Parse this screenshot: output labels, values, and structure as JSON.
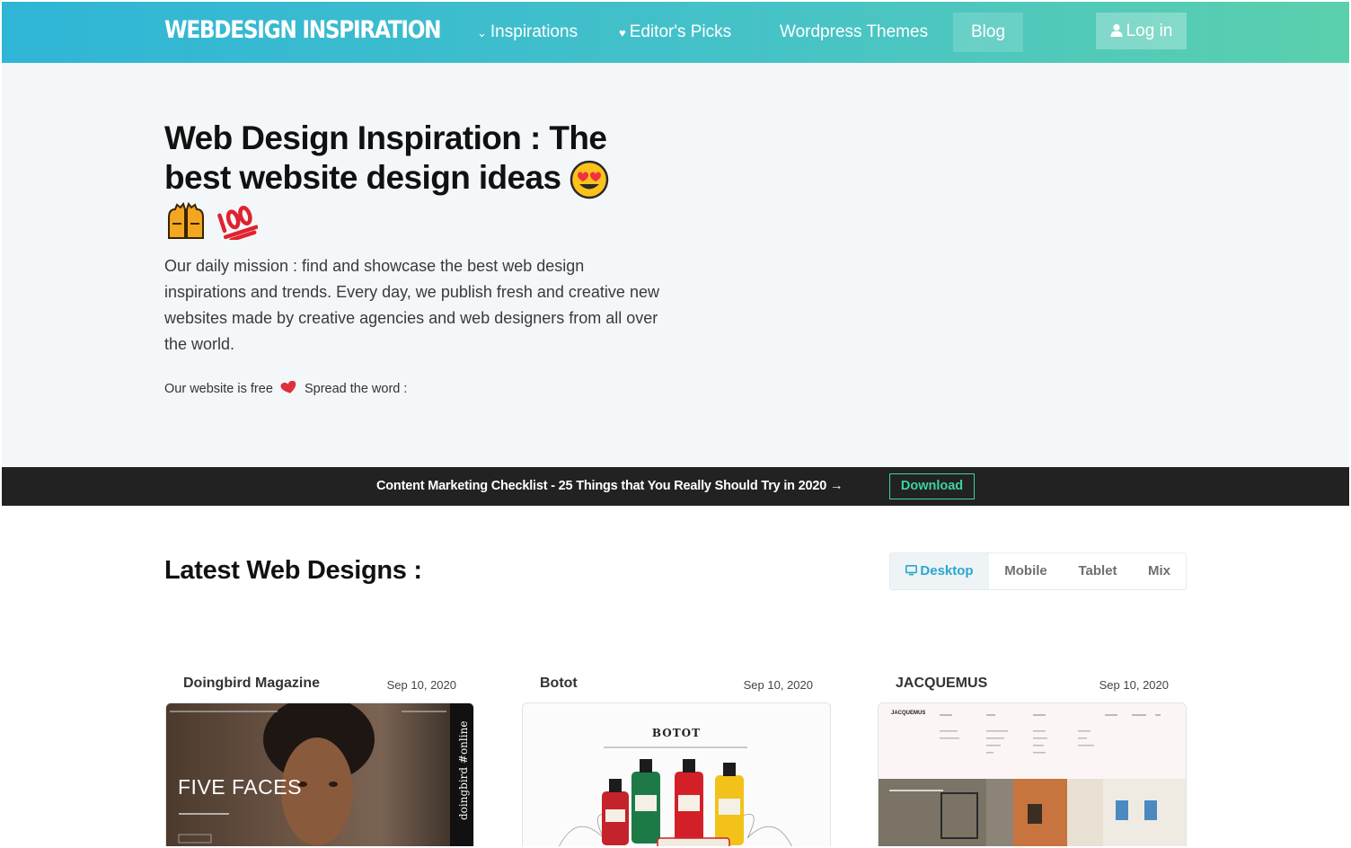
{
  "nav": {
    "logo": "WEBDESIGN INSPIRATION",
    "items": [
      {
        "label": "Inspirations",
        "glyph": "⌄"
      },
      {
        "label": "Editor's Picks",
        "glyph": "♥"
      },
      {
        "label": "Wordpress Themes"
      },
      {
        "label": "Blog"
      }
    ],
    "login_label": "Log in"
  },
  "hero": {
    "title": "Web Design Inspiration : The best website design ideas",
    "description": "Our daily mission : find and showcase the best web design inspirations and trends. Every day, we publish fresh and creative new websites made by creative agencies and web designers from all over the world.",
    "free_text_1": "Our website is free",
    "free_text_2": "Spread the word :"
  },
  "promo": {
    "text": "Content Marketing Checklist - 25 Things that You Really Should Try in 2020 →",
    "button": "Download"
  },
  "latest": {
    "title": "Latest Web Designs :",
    "tabs": [
      {
        "label": "Desktop",
        "active": true
      },
      {
        "label": "Mobile",
        "active": false
      },
      {
        "label": "Tablet",
        "active": false
      },
      {
        "label": "Mix",
        "active": false
      }
    ],
    "cards": [
      {
        "name": "Doingbird Magazine",
        "date": "Sep 10, 2020",
        "thumb_heading": "FIVE FACES",
        "thumb_side": "doingbird #online"
      },
      {
        "name": "Botot",
        "date": "Sep 10, 2020",
        "thumb_heading": "BOTOT"
      },
      {
        "name": "JACQUEMUS",
        "date": "Sep 10, 2020",
        "thumb_heading": "JACQUEMUS"
      }
    ]
  },
  "colors": {
    "nav_gradient_start": "#2fb5d6",
    "nav_gradient_end": "#5bd0ad",
    "promo_bg": "#222222",
    "promo_accent": "#3cd3a0",
    "active_tab": "#2aa6cf"
  }
}
